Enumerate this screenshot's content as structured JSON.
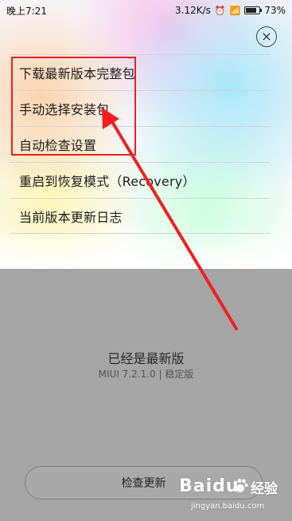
{
  "status_bar": {
    "time": "晚上7:21",
    "network_speed": "3.12K/s",
    "alarm_icon": "alarm-icon",
    "wifi_icon": "wifi-icon",
    "battery": "73%"
  },
  "menu": {
    "items": [
      {
        "label": "下载最新版本完整包"
      },
      {
        "label": "手动选择安装包"
      },
      {
        "label": "自动检查设置"
      },
      {
        "label": "重启到恢复模式（Recovery）"
      },
      {
        "label": "当前版本更新日志"
      }
    ]
  },
  "version": {
    "status": "已经是最新版",
    "detail": "MIUI 7.2.1.0 | 稳定版"
  },
  "actions": {
    "check_update": "检查更新"
  },
  "watermark": {
    "brand": "Baidu",
    "suffix": "经验",
    "url": "jingyan.baidu.com"
  },
  "colors": {
    "highlight": "#f02020",
    "bottom_background": "#a5a5a5"
  }
}
